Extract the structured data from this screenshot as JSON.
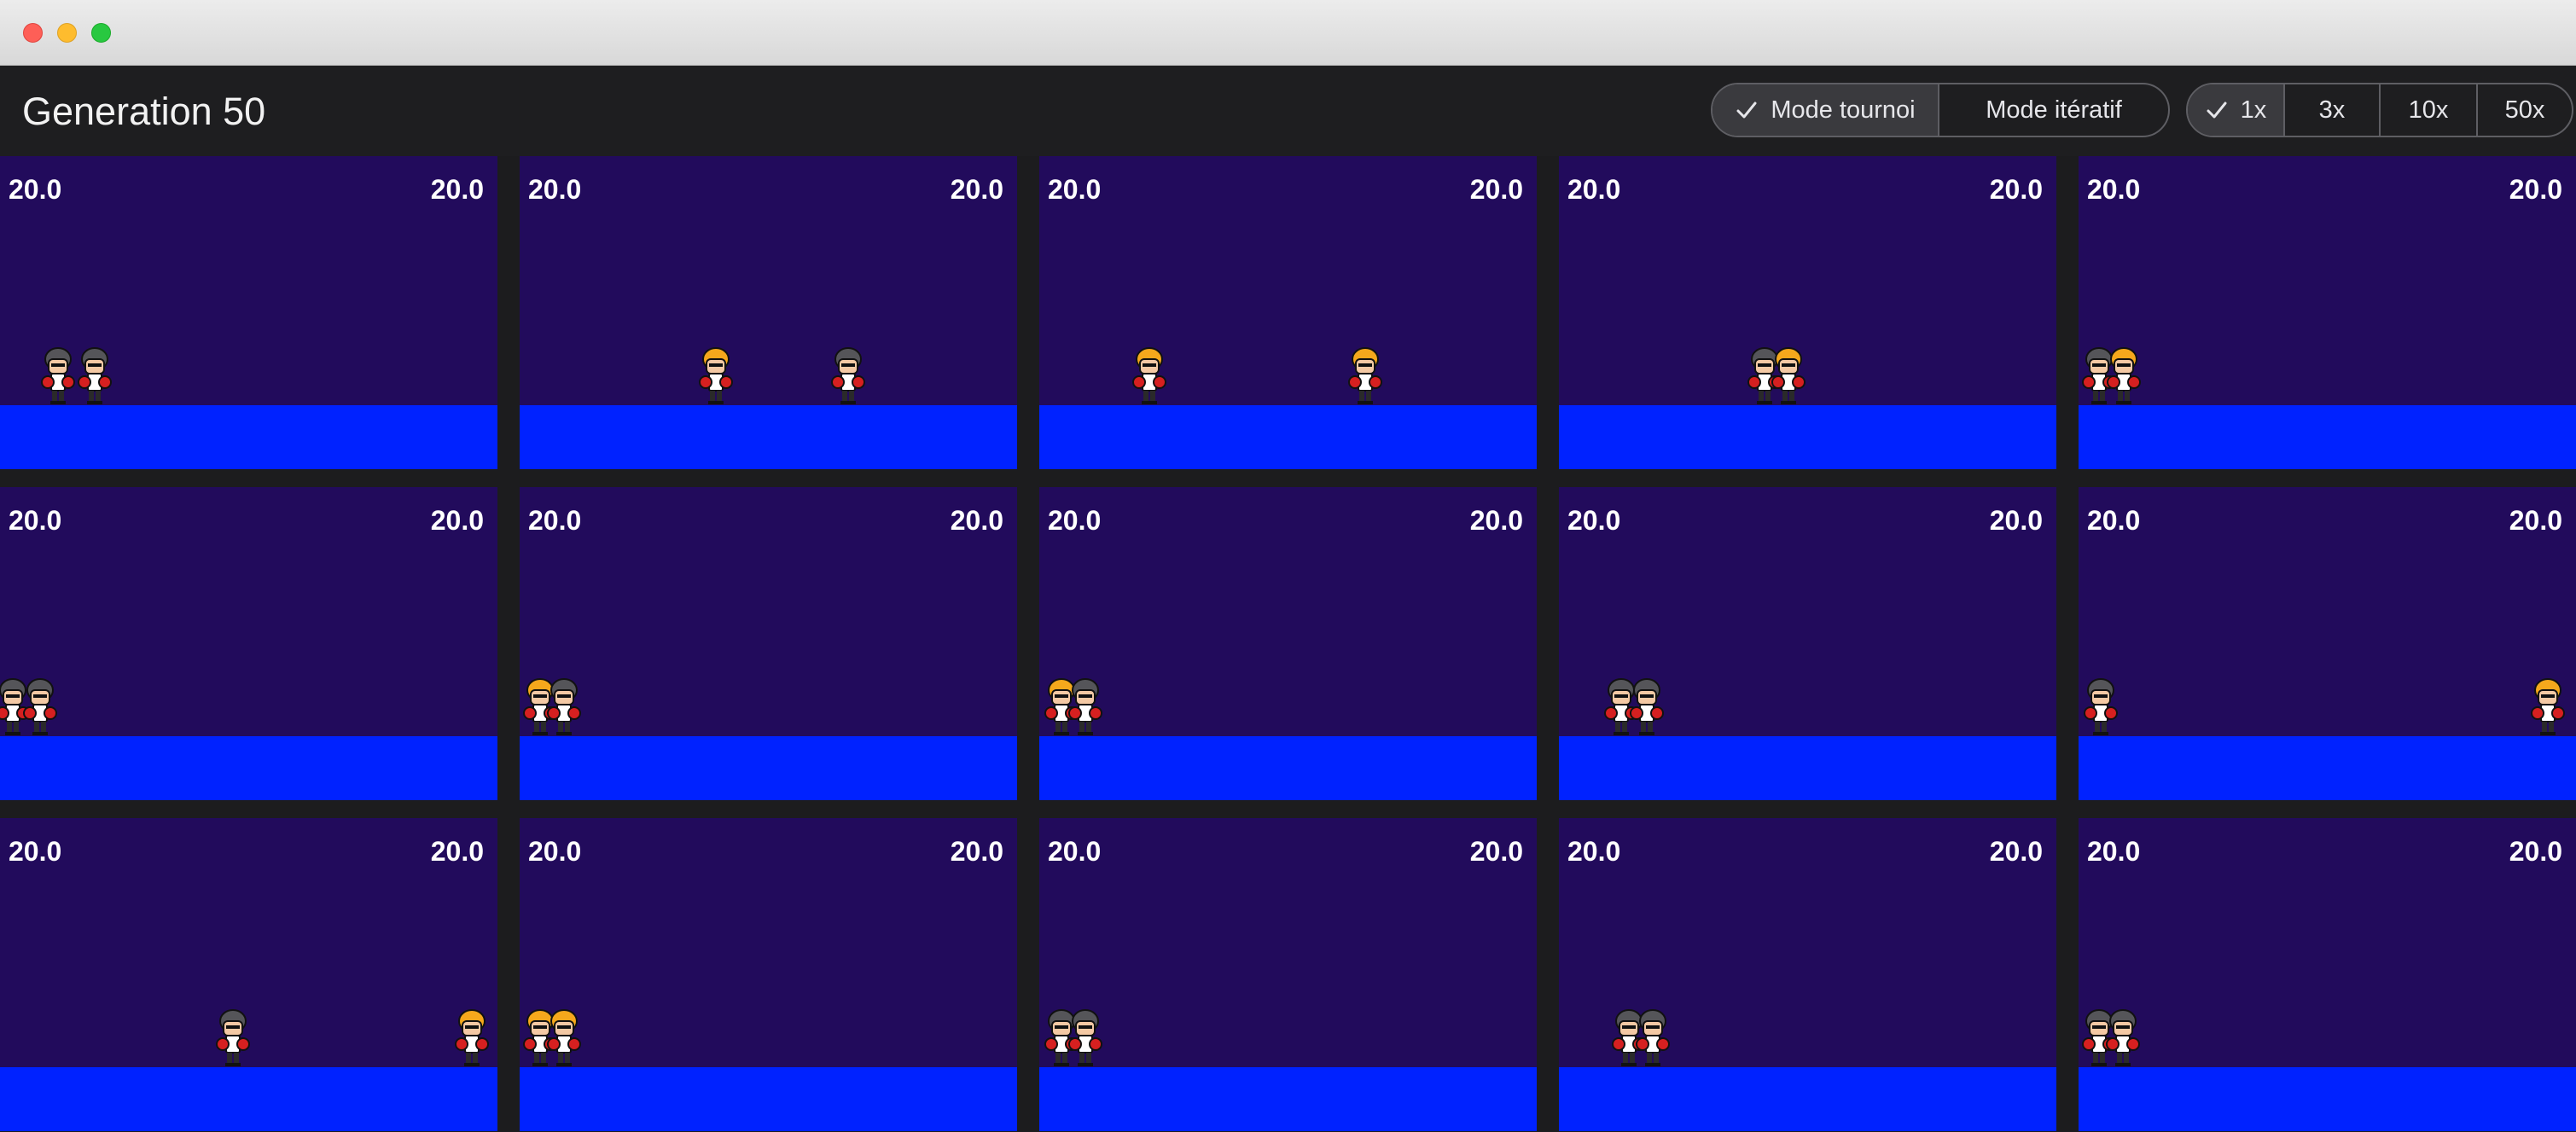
{
  "window": {
    "traffic_lights": [
      "close",
      "minimize",
      "zoom"
    ]
  },
  "header": {
    "title": "Generation 50"
  },
  "mode_segment": {
    "items": [
      {
        "label": "Mode tournoi",
        "selected": true
      },
      {
        "label": "Mode itératif",
        "selected": false
      }
    ]
  },
  "speed_segment": {
    "items": [
      {
        "label": "1x",
        "selected": true
      },
      {
        "label": "3x",
        "selected": false
      },
      {
        "label": "10x",
        "selected": false
      },
      {
        "label": "50x",
        "selected": false
      }
    ]
  },
  "colors": {
    "arena_bg": "#220b5c",
    "floor": "#0022ff",
    "hair_dark": "#555559",
    "hair_blond": "#f5a81c",
    "gloves": "#d62020"
  },
  "arenas": [
    {
      "left_score": "20.0",
      "right_score": "20.0",
      "fighters": [
        {
          "hair": "dark"
        },
        {
          "hair": "dark"
        }
      ]
    },
    {
      "left_score": "20.0",
      "right_score": "20.0",
      "fighters": [
        {
          "hair": "blond"
        },
        {
          "hair": "dark"
        }
      ]
    },
    {
      "left_score": "20.0",
      "right_score": "20.0",
      "fighters": [
        {
          "hair": "blond"
        },
        {
          "hair": "blond"
        }
      ]
    },
    {
      "left_score": "20.0",
      "right_score": "20.0",
      "fighters": [
        {
          "hair": "dark"
        },
        {
          "hair": "blond"
        }
      ]
    },
    {
      "left_score": "20.0",
      "right_score": "20.0",
      "fighters": [
        {
          "hair": "dark"
        },
        {
          "hair": "blond"
        }
      ]
    },
    {
      "left_score": "20.0",
      "right_score": "20.0",
      "fighters": [
        {
          "hair": "dark"
        },
        {
          "hair": "dark"
        }
      ]
    },
    {
      "left_score": "20.0",
      "right_score": "20.0",
      "fighters": [
        {
          "hair": "blond"
        },
        {
          "hair": "dark"
        }
      ]
    },
    {
      "left_score": "20.0",
      "right_score": "20.0",
      "fighters": [
        {
          "hair": "blond"
        },
        {
          "hair": "dark"
        }
      ]
    },
    {
      "left_score": "20.0",
      "right_score": "20.0",
      "fighters": [
        {
          "hair": "dark"
        },
        {
          "hair": "dark"
        }
      ]
    },
    {
      "left_score": "20.0",
      "right_score": "20.0",
      "fighters": [
        {
          "hair": "dark"
        },
        {
          "hair": "blond"
        }
      ]
    },
    {
      "left_score": "20.0",
      "right_score": "20.0",
      "fighters": [
        {
          "hair": "dark"
        },
        {
          "hair": "blond"
        }
      ]
    },
    {
      "left_score": "20.0",
      "right_score": "20.0",
      "fighters": [
        {
          "hair": "blond"
        },
        {
          "hair": "blond"
        }
      ]
    },
    {
      "left_score": "20.0",
      "right_score": "20.0",
      "fighters": [
        {
          "hair": "dark"
        },
        {
          "hair": "dark"
        }
      ]
    },
    {
      "left_score": "20.0",
      "right_score": "20.0",
      "fighters": [
        {
          "hair": "dark"
        },
        {
          "hair": "dark"
        }
      ]
    },
    {
      "left_score": "20.0",
      "right_score": "20.0",
      "fighters": [
        {
          "hair": "dark"
        },
        {
          "hair": "dark"
        }
      ]
    }
  ]
}
